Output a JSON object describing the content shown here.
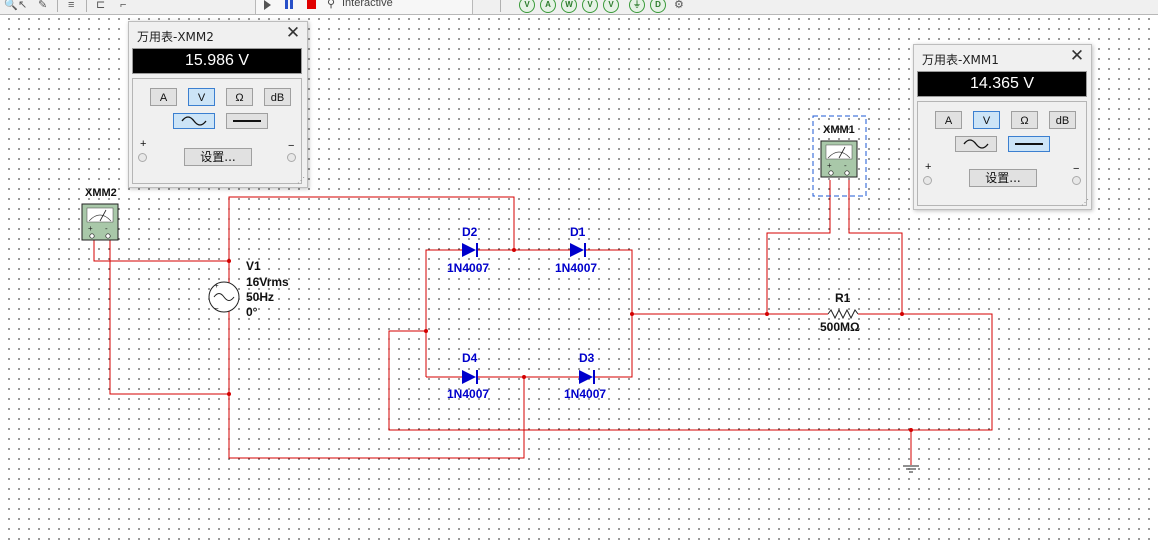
{
  "toolbar": {
    "mode_label": "Interactive"
  },
  "schematic": {
    "xmm2": {
      "label": "XMM2"
    },
    "xmm1": {
      "label": "XMM1"
    },
    "v1": {
      "name": "V1",
      "value": "16Vrms",
      "freq": "50Hz",
      "phase": "0°"
    },
    "d1": {
      "name": "D1",
      "model": "1N4007"
    },
    "d2": {
      "name": "D2",
      "model": "1N4007"
    },
    "d3": {
      "name": "D3",
      "model": "1N4007"
    },
    "d4": {
      "name": "D4",
      "model": "1N4007"
    },
    "r1": {
      "name": "R1",
      "value": "500MΩ"
    }
  },
  "multimeter2": {
    "title": "万用表-XMM2",
    "close": "✕",
    "reading": "15.986 V",
    "modes": [
      "A",
      "V",
      "Ω",
      "dB"
    ],
    "selected_mode": "V",
    "selected_waveform": "ac",
    "settings_label": "设置...",
    "plus": "+",
    "minus": "−"
  },
  "multimeter1": {
    "title": "万用表-XMM1",
    "close": "✕",
    "reading": "14.365 V",
    "modes": [
      "A",
      "V",
      "Ω",
      "dB"
    ],
    "selected_mode": "V",
    "selected_waveform": "dc",
    "settings_label": "设置...",
    "plus": "+",
    "minus": "−"
  },
  "colors": {
    "wire": "#d40000",
    "component": "#0000cc",
    "background": "#ffffff",
    "selection": "#1c58d6"
  }
}
